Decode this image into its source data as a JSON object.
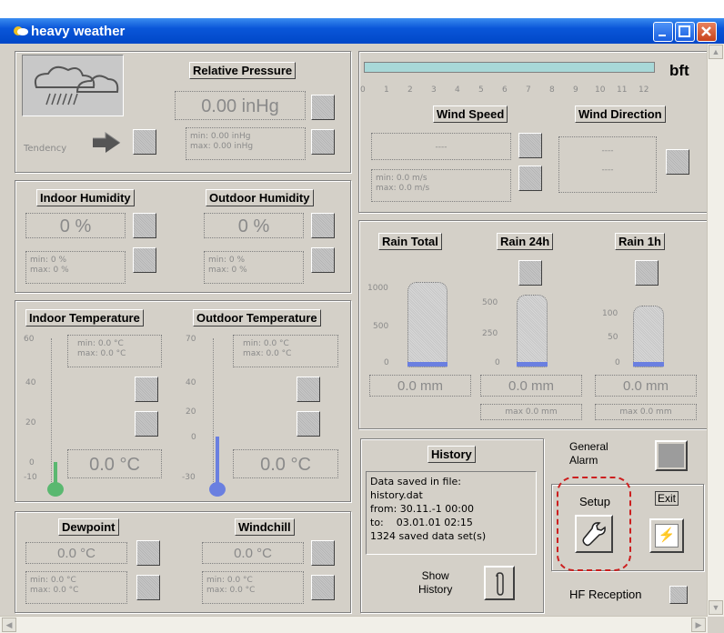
{
  "window": {
    "title": "heavy weather"
  },
  "pressure": {
    "header": "Relative Pressure",
    "value": "0.00 inHg",
    "tendency_label": "Tendency",
    "minmax": [
      "min: 0.00 inHg",
      "max: 0.00 inHg"
    ]
  },
  "wind": {
    "scale_label": "bft",
    "scale_ticks": [
      "0",
      "1",
      "2",
      "3",
      "4",
      "5",
      "6",
      "7",
      "8",
      "9",
      "10",
      "11",
      "12"
    ],
    "speed_header": "Wind Speed",
    "direction_header": "Wind Direction",
    "speed_value": "----",
    "direction_value": [
      "----",
      "----"
    ],
    "minmax": [
      "min: 0.0 m/s",
      "max: 0.0 m/s"
    ]
  },
  "humidity": {
    "indoor": {
      "header": "Indoor Humidity",
      "value": "0 %",
      "minmax": [
        "min: 0 %",
        "max: 0 %"
      ]
    },
    "outdoor": {
      "header": "Outdoor Humidity",
      "value": "0 %",
      "minmax": [
        "min: 0 %",
        "max: 0 %"
      ]
    }
  },
  "rain": {
    "total": {
      "header": "Rain Total",
      "value": "0.0 mm",
      "ticks": [
        "1000",
        "500",
        "0"
      ]
    },
    "day": {
      "header": "Rain 24h",
      "value": "0.0 mm",
      "max": "max 0.0 mm",
      "ticks": [
        "500",
        "250",
        "0"
      ]
    },
    "hour": {
      "header": "Rain 1h",
      "value": "0.0 mm",
      "max": "max 0.0 mm",
      "ticks": [
        "100",
        "50",
        "0"
      ]
    }
  },
  "temperature": {
    "indoor": {
      "header": "Indoor Temperature",
      "value": "0.0 °C",
      "minmax": [
        "min: 0.0 °C",
        "max: 0.0 °C"
      ],
      "ticks": [
        "60",
        "40",
        "20",
        "0",
        "-10"
      ],
      "level": 0.0
    },
    "outdoor": {
      "header": "Outdoor Temperature",
      "value": "0.0 °C",
      "minmax": [
        "min: 0.0 °C",
        "max: 0.0 °C"
      ],
      "ticks": [
        "70",
        "40",
        "20",
        "0",
        "-30"
      ],
      "level": 0.0
    }
  },
  "dewpoint": {
    "header": "Dewpoint",
    "value": "0.0 °C",
    "minmax": [
      "min: 0.0 °C",
      "max: 0.0 °C"
    ]
  },
  "windchill": {
    "header": "Windchill",
    "value": "0.0 °C",
    "minmax": [
      "min: 0.0 °C",
      "max: 0.0 °C"
    ]
  },
  "history": {
    "header": "History",
    "lines": [
      "Data saved in file:",
      "history.dat",
      "from: 30.11.-1 00:00",
      "to:    03.01.01 02:15",
      "1324 saved data set(s)"
    ],
    "show_label": [
      "Show",
      "History"
    ]
  },
  "general_alarm": "General Alarm",
  "setup_label": "Setup",
  "exit_label": "Exit",
  "hf_reception": "HF Reception",
  "colors": {
    "title_bar": "#0a56d8",
    "setup_highlight": "#cc1f1f",
    "thermo_fill": "#6a7fe0",
    "thermo_bulb": "#5ab870"
  }
}
